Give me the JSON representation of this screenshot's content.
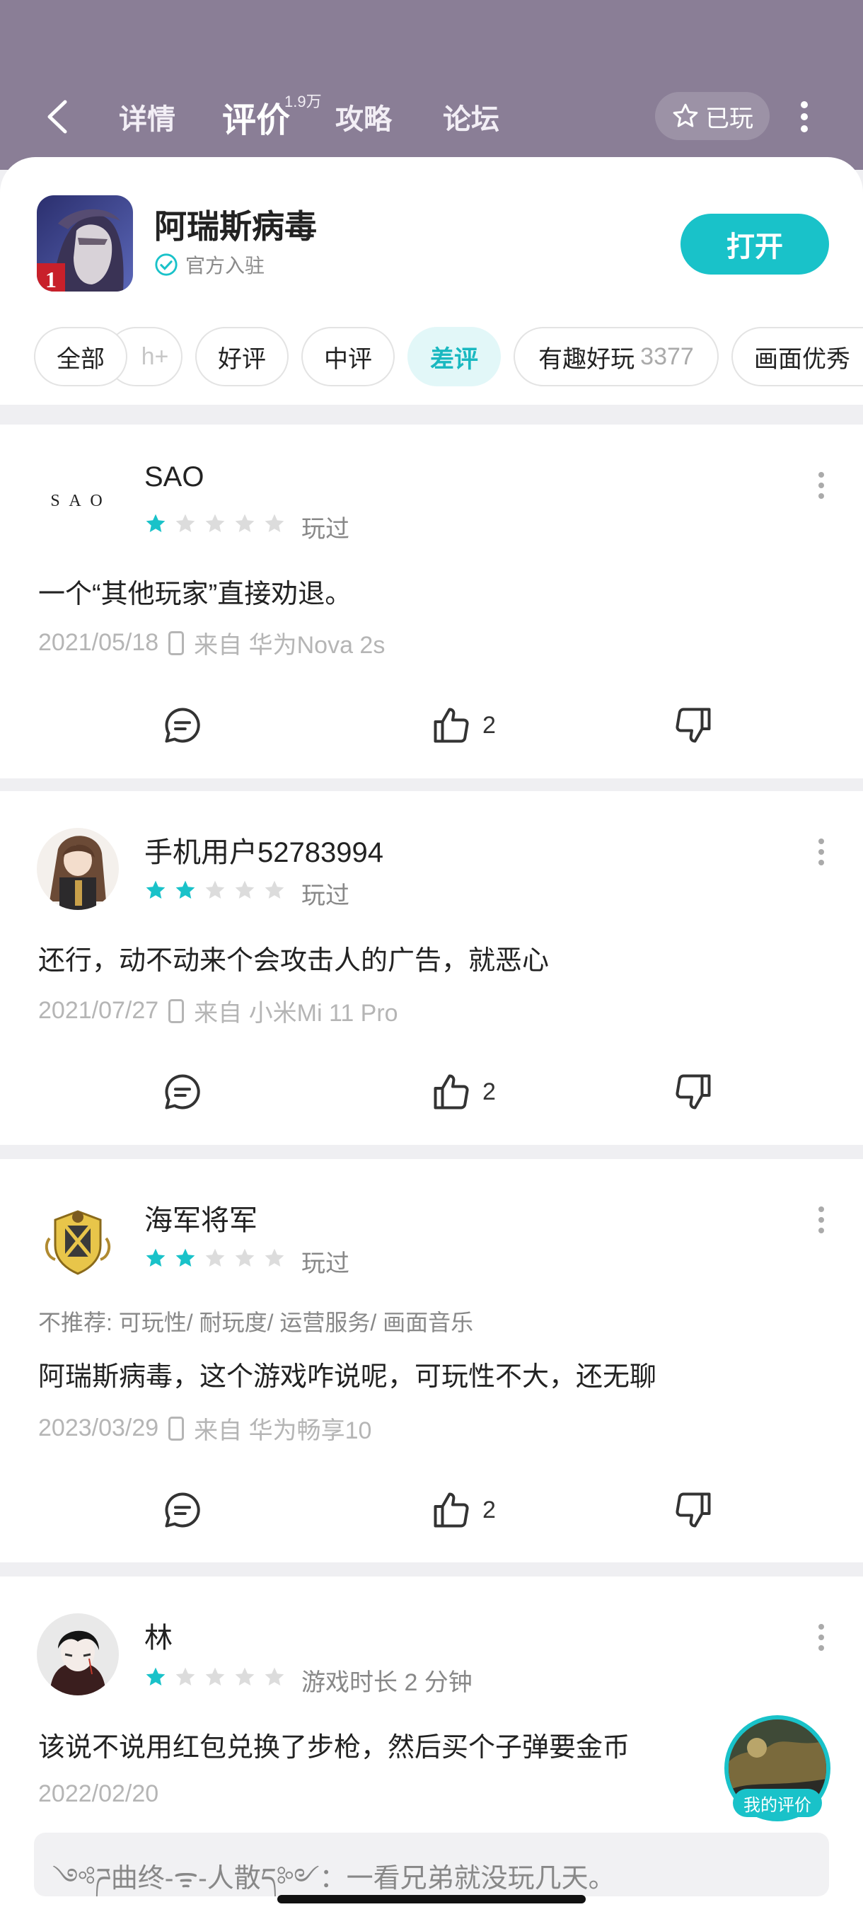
{
  "header": {
    "tabs": [
      {
        "label": "详情"
      },
      {
        "label": "评价",
        "badge": "1.9万"
      },
      {
        "label": "攻略"
      },
      {
        "label": "论坛"
      }
    ],
    "played_label": "已玩"
  },
  "app": {
    "name": "阿瑞斯病毒",
    "verified_label": "官方入驻",
    "icon_badge": "1",
    "open_label": "打开"
  },
  "filters": [
    {
      "label": "全部"
    },
    {
      "label": "h+"
    },
    {
      "label": "好评"
    },
    {
      "label": "中评"
    },
    {
      "label": "差评",
      "active": true
    },
    {
      "label": "有趣好玩",
      "count": "3377"
    },
    {
      "label": "画面优秀"
    }
  ],
  "reviews": [
    {
      "user": "SAO",
      "avatar_text": "S A O",
      "rating": 1,
      "status": "玩过",
      "text": "一个“其他玩家”直接劝退。",
      "date": "2021/05/18",
      "source": "来自 华为Nova 2s",
      "likes": "2"
    },
    {
      "user": "手机用户52783994",
      "rating": 2,
      "status": "玩过",
      "text": "还行，动不动来个会攻击人的广告，就恶心",
      "date": "2021/07/27",
      "source": "来自 小米Mi 11 Pro",
      "likes": "2"
    },
    {
      "user": "海军将军",
      "rating": 2,
      "status": "玩过",
      "tags": "不推荐: 可玩性/ 耐玩度/ 运营服务/ 画面音乐",
      "text": "阿瑞斯病毒，这个游戏咋说呢，可玩性不大，还无聊",
      "date": "2023/03/29",
      "source": "来自 华为畅享10",
      "likes": "2"
    },
    {
      "user": "林",
      "rating": 1,
      "status": "游戏时长 2 分钟",
      "text": "该说不说用红包兑换了步枪，然后买个子弹要金币",
      "date": "2022/02/20",
      "reply": "༺ཌ曲终-ᯤ-人散ད༻：一看兄弟就没玩几天。"
    }
  ],
  "my_review_label": "我的评价",
  "colors": {
    "accent": "#19c2c9",
    "header_bg": "#8a7e96"
  }
}
